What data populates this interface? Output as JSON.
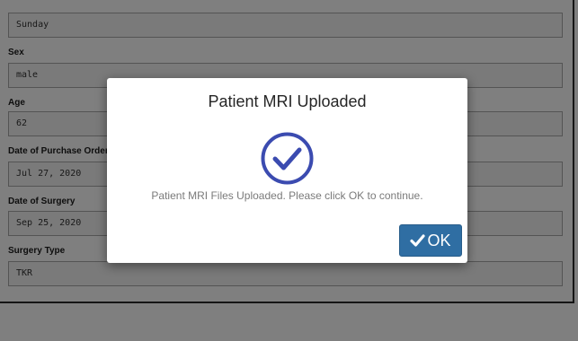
{
  "form": {
    "fields": [
      {
        "label": "",
        "value": "Sunday"
      },
      {
        "label": "Sex",
        "value": "male"
      },
      {
        "label": "Age",
        "value": "62"
      },
      {
        "label": "Date of Purchase Order",
        "value": "Jul 27, 2020"
      },
      {
        "label": "Date of Surgery",
        "value": "Sep 25, 2020"
      },
      {
        "label": "Surgery Type",
        "value": "TKR"
      }
    ]
  },
  "modal": {
    "title": "Patient MRI Uploaded",
    "icon": "check-circle-icon",
    "message": "Patient MRI Files Uploaded. Please click OK to continue.",
    "ok_label": "OK",
    "ok_icon": "checkmark-icon"
  },
  "colors": {
    "accent": "#3b4bb0",
    "button": "#2f6ea3",
    "overlay": "rgba(0,0,0,0.5)"
  }
}
